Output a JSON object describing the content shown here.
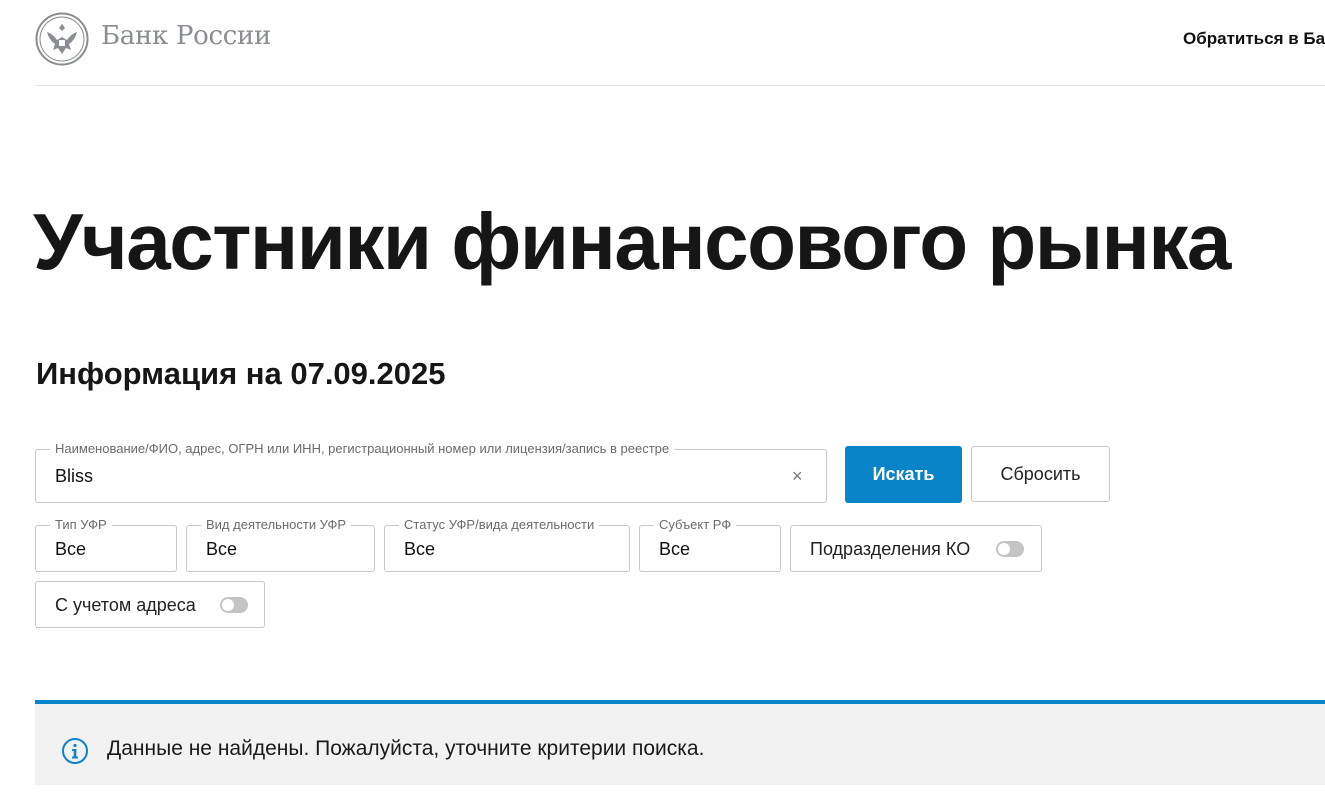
{
  "header": {
    "logo_text": "Банк России",
    "contact_link": "Обратиться в Ба"
  },
  "main": {
    "title": "Участники финансового рынка",
    "info_date": "Информация на 07.09.2025"
  },
  "search": {
    "legend": "Наименование/ФИО, адрес, ОГРН или ИНН, регистрационный номер или лицензия/запись в реестре",
    "value": "Bliss",
    "clear_icon": "×",
    "search_button": "Искать",
    "reset_button": "Сбросить"
  },
  "filters": {
    "type": {
      "legend": "Тип УФР",
      "value": "Все"
    },
    "activity": {
      "legend": "Вид деятельности УФР",
      "value": "Все"
    },
    "status": {
      "legend": "Статус УФР/вида деятельности",
      "value": "Все"
    },
    "region": {
      "legend": "Субъект РФ",
      "value": "Все"
    },
    "ko_toggle": {
      "label": "Подразделения КО",
      "on": false
    },
    "address_toggle": {
      "label": "С учетом адреса",
      "on": false
    }
  },
  "notice": {
    "text": "Данные не найдены. Пожалуйста, уточните критерии поиска.",
    "icon": "info-icon"
  },
  "colors": {
    "accent": "#0a84c9",
    "notice_bg": "#f2f2f2",
    "logo_gray": "#8a8d91"
  }
}
